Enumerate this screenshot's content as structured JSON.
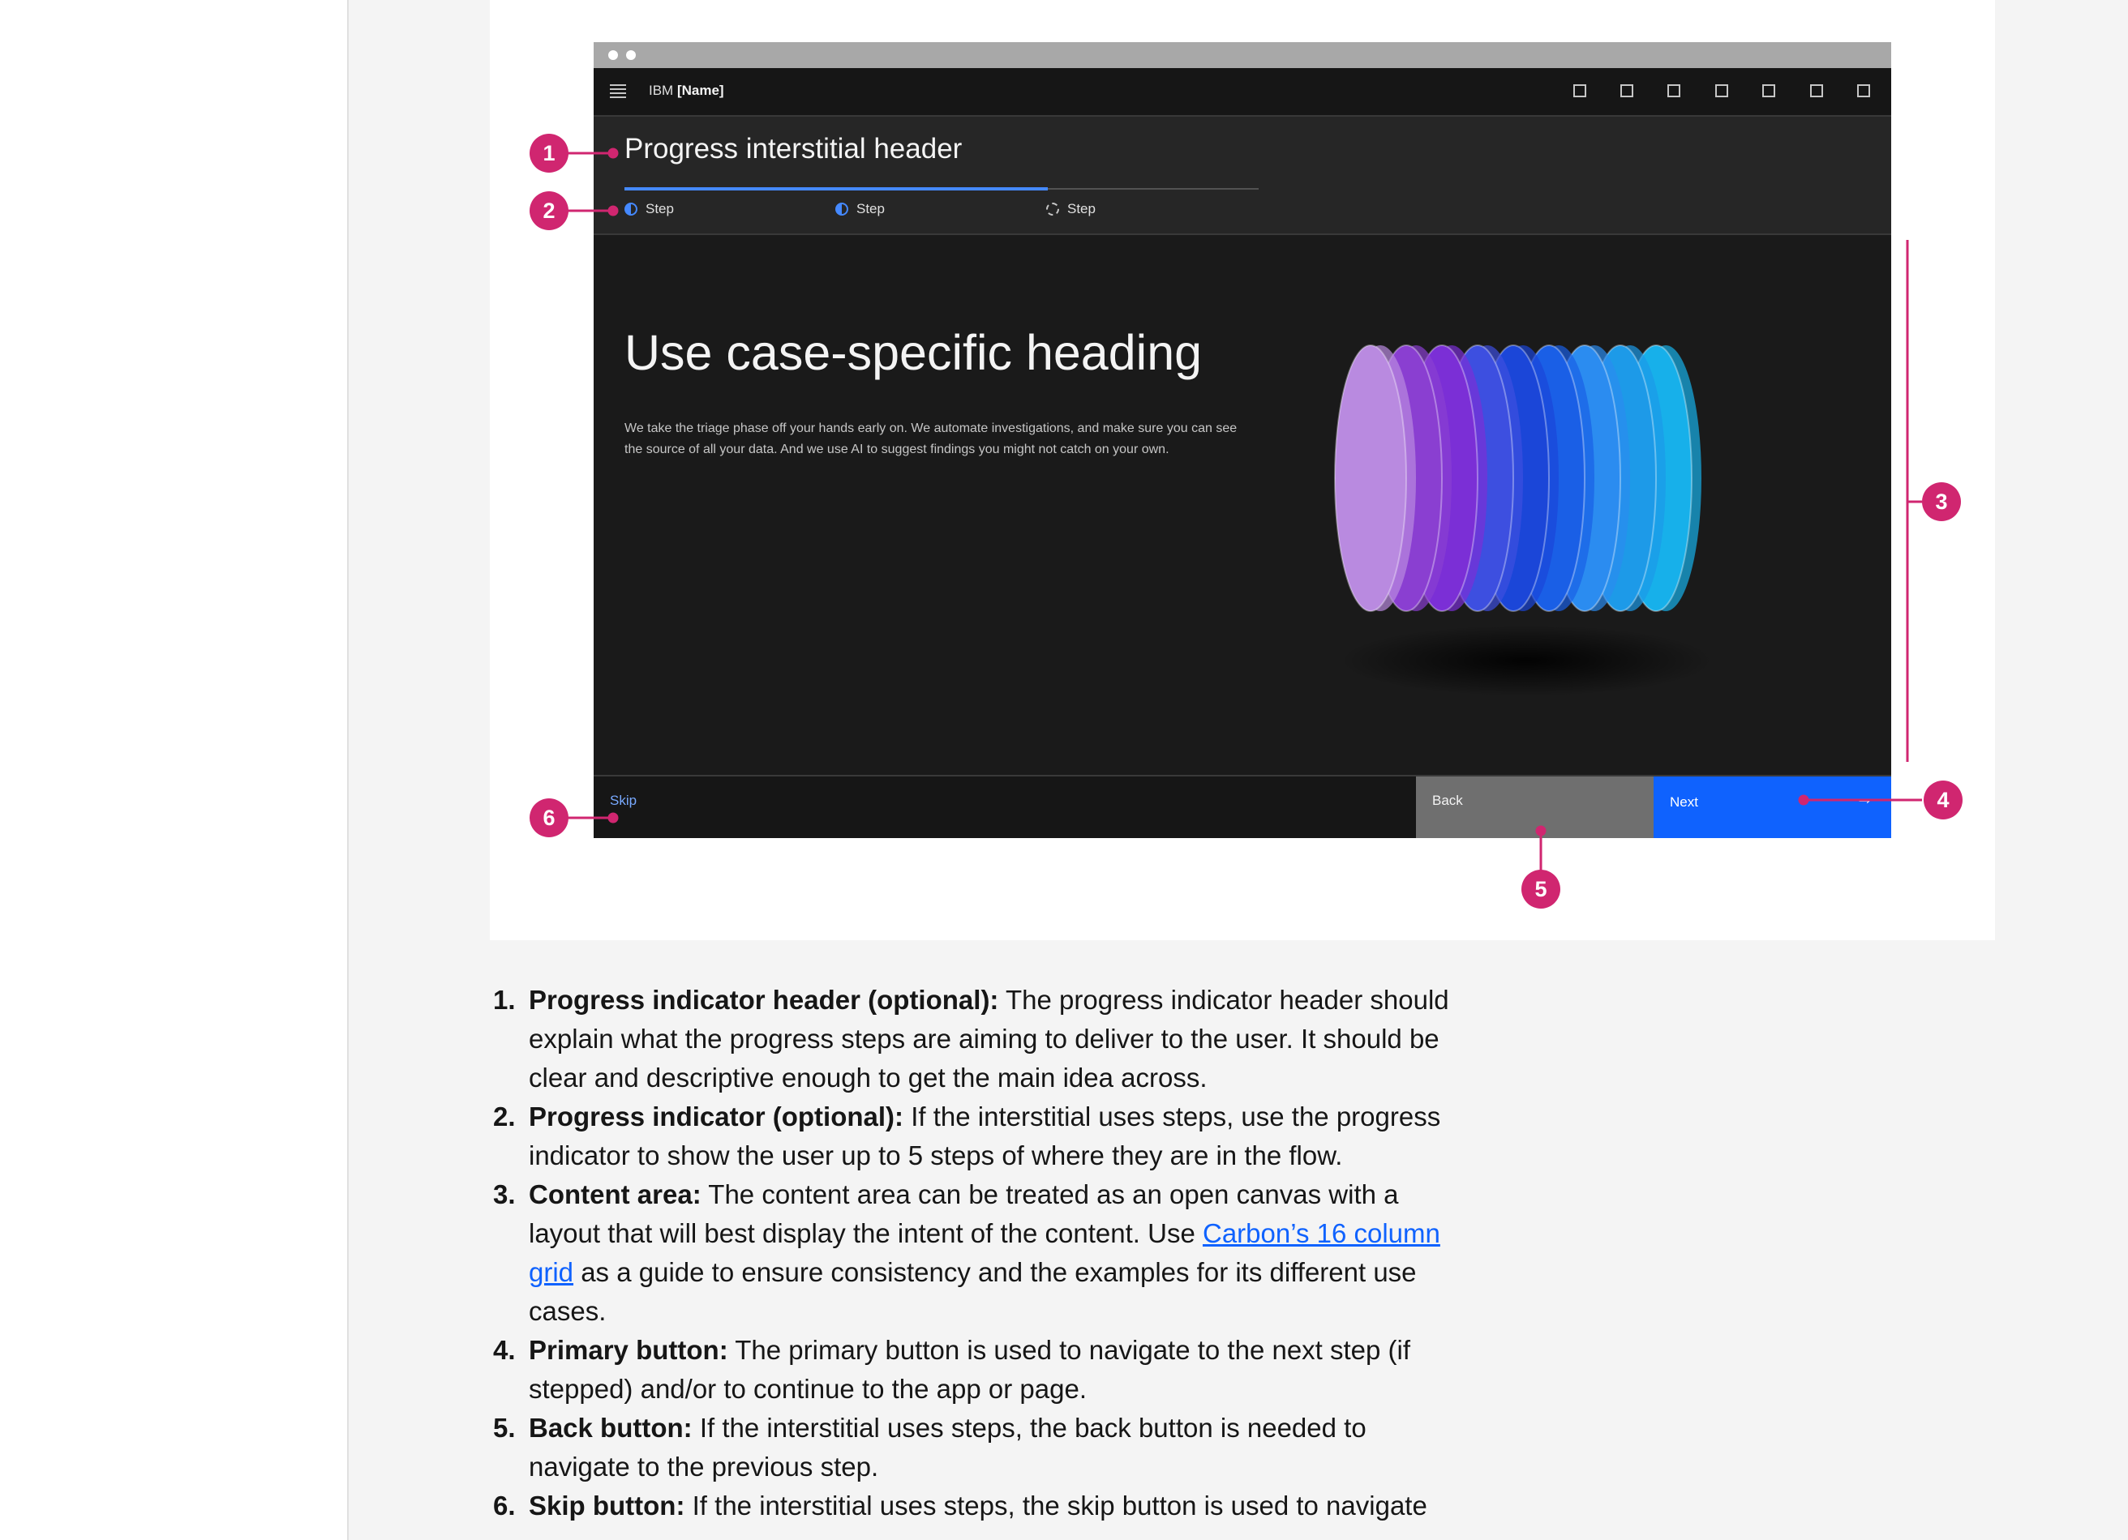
{
  "mockup": {
    "brand_prefix": "IBM",
    "brand_name": "[Name]",
    "header_title": "Progress interstitial header",
    "progress_value": 0.667,
    "steps": [
      {
        "label": "Step",
        "state": "in-progress"
      },
      {
        "label": "Step",
        "state": "in-progress"
      },
      {
        "label": "Step",
        "state": "not-started"
      }
    ],
    "content": {
      "heading": "Use case-specific heading",
      "body": "We take the triage phase off your hands early on. We automate investigations, and make sure you can see the source of all your data. And we use AI to suggest findings you might not catch on your own."
    },
    "footer": {
      "skip_label": "Skip",
      "back_label": "Back",
      "next_label": "Next",
      "next_icon": "arrow-right-icon"
    }
  },
  "callouts": [
    "1",
    "2",
    "3",
    "4",
    "5",
    "6"
  ],
  "colors": {
    "callout": "#d02670",
    "primary": "#0f62fe",
    "secondary": "#6f6f6f",
    "progress": "#4589ff"
  },
  "descriptions": [
    {
      "num": "1.",
      "term": "Progress indicator header (optional):",
      "text": "The progress indicator header should explain what the progress steps are aiming to deliver to the user. It should be clear and descriptive enough to get the main idea across."
    },
    {
      "num": "2.",
      "term": "Progress indicator (optional):",
      "text": "If the interstitial uses steps, use the progress indicator to show the user up to 5 steps of where they are in the flow."
    },
    {
      "num": "3.",
      "term": "Content area:",
      "text_before": "The content area can be treated as an open canvas with a layout that will best display the intent of the content. Use",
      "link": "Carbon’s 16 column grid",
      "text_after": "as a guide to ensure consistency and the examples for its different use cases."
    },
    {
      "num": "4.",
      "term": "Primary button:",
      "text": "The primary button is used to navigate to the next step (if stepped) and/or to continue to the app or page."
    },
    {
      "num": "5.",
      "term": "Back button:",
      "text": "If the interstitial uses steps, the back button is needed to navigate to the previous step."
    },
    {
      "num": "6.",
      "term": "Skip button:",
      "text": "If the interstitial uses steps, the skip button is used to navigate"
    }
  ]
}
